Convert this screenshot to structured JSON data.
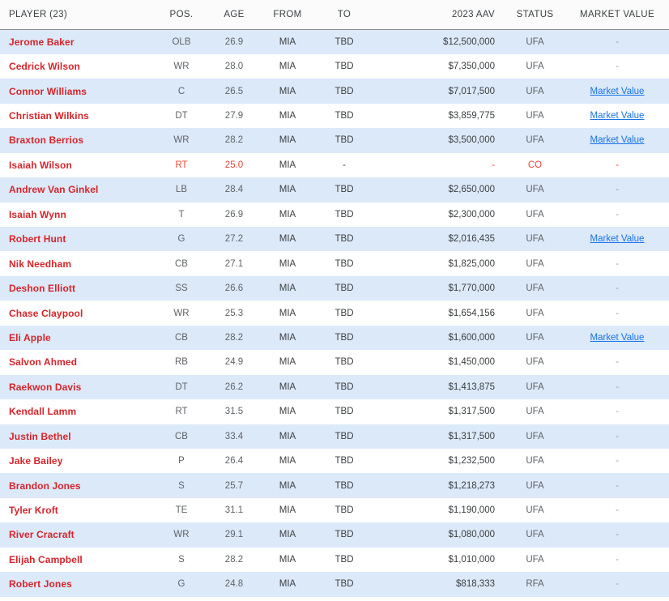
{
  "table": {
    "columns": [
      {
        "key": "player",
        "label": "PLAYER (23)",
        "align": "left"
      },
      {
        "key": "pos",
        "label": "POS.",
        "align": "center"
      },
      {
        "key": "age",
        "label": "AGE",
        "align": "center"
      },
      {
        "key": "from",
        "label": "FROM",
        "align": "center"
      },
      {
        "key": "to",
        "label": "TO",
        "align": "center"
      },
      {
        "key": "aav",
        "label": "2023 AAV",
        "align": "right"
      },
      {
        "key": "status",
        "label": "STATUS",
        "align": "center"
      },
      {
        "key": "mv",
        "label": "MARKET VALUE",
        "align": "center"
      }
    ],
    "market_value_link_label": "Market Value",
    "empty_dash": "-",
    "player_count": 23,
    "colors": {
      "player_name": "#d6252b",
      "link": "#1a73e8",
      "alt_row_background": "#dce9f9",
      "row_background": "#ffffff",
      "header_background": "#fbfbfb",
      "header_rule": "#8b8b8b",
      "alert_text": "#ea4335",
      "body_text": "#5f6368",
      "dash": "#9aa0a6"
    },
    "rows": [
      {
        "player": "Jerome Baker",
        "pos": "OLB",
        "age": "26.9",
        "from": "MIA",
        "to": "TBD",
        "aav": "$12,500,000",
        "status": "UFA",
        "mv": "-",
        "mv_is_link": false,
        "alert": false
      },
      {
        "player": "Cedrick Wilson",
        "pos": "WR",
        "age": "28.0",
        "from": "MIA",
        "to": "TBD",
        "aav": "$7,350,000",
        "status": "UFA",
        "mv": "-",
        "mv_is_link": false,
        "alert": false
      },
      {
        "player": "Connor Williams",
        "pos": "C",
        "age": "26.5",
        "from": "MIA",
        "to": "TBD",
        "aav": "$7,017,500",
        "status": "UFA",
        "mv": "Market Value",
        "mv_is_link": true,
        "alert": false
      },
      {
        "player": "Christian Wilkins",
        "pos": "DT",
        "age": "27.9",
        "from": "MIA",
        "to": "TBD",
        "aav": "$3,859,775",
        "status": "UFA",
        "mv": "Market Value",
        "mv_is_link": true,
        "alert": false
      },
      {
        "player": "Braxton Berrios",
        "pos": "WR",
        "age": "28.2",
        "from": "MIA",
        "to": "TBD",
        "aav": "$3,500,000",
        "status": "UFA",
        "mv": "Market Value",
        "mv_is_link": true,
        "alert": false
      },
      {
        "player": "Isaiah Wilson",
        "pos": "RT",
        "age": "25.0",
        "from": "MIA",
        "to": "-",
        "aav": "-",
        "status": "CO",
        "mv": "-",
        "mv_is_link": false,
        "alert": true
      },
      {
        "player": "Andrew Van Ginkel",
        "pos": "LB",
        "age": "28.4",
        "from": "MIA",
        "to": "TBD",
        "aav": "$2,650,000",
        "status": "UFA",
        "mv": "-",
        "mv_is_link": false,
        "alert": false
      },
      {
        "player": "Isaiah Wynn",
        "pos": "T",
        "age": "26.9",
        "from": "MIA",
        "to": "TBD",
        "aav": "$2,300,000",
        "status": "UFA",
        "mv": "-",
        "mv_is_link": false,
        "alert": false
      },
      {
        "player": "Robert Hunt",
        "pos": "G",
        "age": "27.2",
        "from": "MIA",
        "to": "TBD",
        "aav": "$2,016,435",
        "status": "UFA",
        "mv": "Market Value",
        "mv_is_link": true,
        "alert": false
      },
      {
        "player": "Nik Needham",
        "pos": "CB",
        "age": "27.1",
        "from": "MIA",
        "to": "TBD",
        "aav": "$1,825,000",
        "status": "UFA",
        "mv": "-",
        "mv_is_link": false,
        "alert": false
      },
      {
        "player": "Deshon Elliott",
        "pos": "SS",
        "age": "26.6",
        "from": "MIA",
        "to": "TBD",
        "aav": "$1,770,000",
        "status": "UFA",
        "mv": "-",
        "mv_is_link": false,
        "alert": false
      },
      {
        "player": "Chase Claypool",
        "pos": "WR",
        "age": "25.3",
        "from": "MIA",
        "to": "TBD",
        "aav": "$1,654,156",
        "status": "UFA",
        "mv": "-",
        "mv_is_link": false,
        "alert": false
      },
      {
        "player": "Eli Apple",
        "pos": "CB",
        "age": "28.2",
        "from": "MIA",
        "to": "TBD",
        "aav": "$1,600,000",
        "status": "UFA",
        "mv": "Market Value",
        "mv_is_link": true,
        "alert": false
      },
      {
        "player": "Salvon Ahmed",
        "pos": "RB",
        "age": "24.9",
        "from": "MIA",
        "to": "TBD",
        "aav": "$1,450,000",
        "status": "UFA",
        "mv": "-",
        "mv_is_link": false,
        "alert": false
      },
      {
        "player": "Raekwon Davis",
        "pos": "DT",
        "age": "26.2",
        "from": "MIA",
        "to": "TBD",
        "aav": "$1,413,875",
        "status": "UFA",
        "mv": "-",
        "mv_is_link": false,
        "alert": false
      },
      {
        "player": "Kendall Lamm",
        "pos": "RT",
        "age": "31.5",
        "from": "MIA",
        "to": "TBD",
        "aav": "$1,317,500",
        "status": "UFA",
        "mv": "-",
        "mv_is_link": false,
        "alert": false
      },
      {
        "player": "Justin Bethel",
        "pos": "CB",
        "age": "33.4",
        "from": "MIA",
        "to": "TBD",
        "aav": "$1,317,500",
        "status": "UFA",
        "mv": "-",
        "mv_is_link": false,
        "alert": false
      },
      {
        "player": "Jake Bailey",
        "pos": "P",
        "age": "26.4",
        "from": "MIA",
        "to": "TBD",
        "aav": "$1,232,500",
        "status": "UFA",
        "mv": "-",
        "mv_is_link": false,
        "alert": false
      },
      {
        "player": "Brandon Jones",
        "pos": "S",
        "age": "25.7",
        "from": "MIA",
        "to": "TBD",
        "aav": "$1,218,273",
        "status": "UFA",
        "mv": "-",
        "mv_is_link": false,
        "alert": false
      },
      {
        "player": "Tyler Kroft",
        "pos": "TE",
        "age": "31.1",
        "from": "MIA",
        "to": "TBD",
        "aav": "$1,190,000",
        "status": "UFA",
        "mv": "-",
        "mv_is_link": false,
        "alert": false
      },
      {
        "player": "River Cracraft",
        "pos": "WR",
        "age": "29.1",
        "from": "MIA",
        "to": "TBD",
        "aav": "$1,080,000",
        "status": "UFA",
        "mv": "-",
        "mv_is_link": false,
        "alert": false
      },
      {
        "player": "Elijah Campbell",
        "pos": "S",
        "age": "28.2",
        "from": "MIA",
        "to": "TBD",
        "aav": "$1,010,000",
        "status": "UFA",
        "mv": "-",
        "mv_is_link": false,
        "alert": false
      },
      {
        "player": "Robert Jones",
        "pos": "G",
        "age": "24.8",
        "from": "MIA",
        "to": "TBD",
        "aav": "$818,333",
        "status": "RFA",
        "mv": "-",
        "mv_is_link": false,
        "alert": false
      }
    ]
  }
}
